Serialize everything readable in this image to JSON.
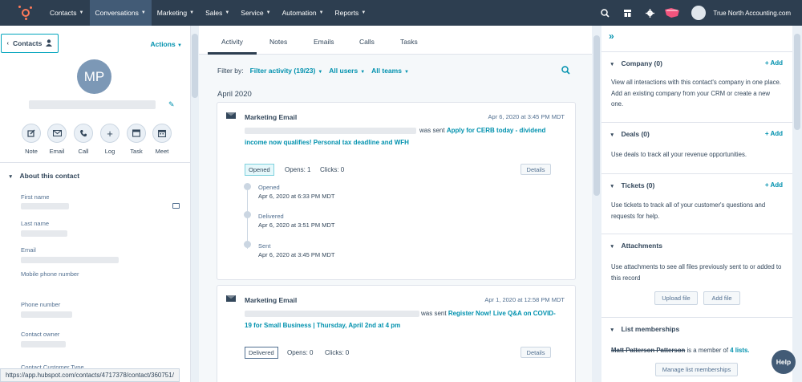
{
  "topnav": {
    "items": [
      {
        "label": "Contacts",
        "active": false
      },
      {
        "label": "Conversations",
        "active": true
      },
      {
        "label": "Marketing",
        "active": false
      },
      {
        "label": "Sales",
        "active": false
      },
      {
        "label": "Service",
        "active": false
      },
      {
        "label": "Automation",
        "active": false
      },
      {
        "label": "Reports",
        "active": false
      }
    ],
    "account": "True North Accounting.com"
  },
  "left": {
    "back_label": "Contacts",
    "actions_label": "Actions",
    "avatar_initials": "MP",
    "quick_actions": [
      {
        "label": "Note",
        "icon": "note-icon"
      },
      {
        "label": "Email",
        "icon": "email-icon"
      },
      {
        "label": "Call",
        "icon": "call-icon"
      },
      {
        "label": "Log",
        "icon": "plus-icon"
      },
      {
        "label": "Task",
        "icon": "task-icon"
      },
      {
        "label": "Meet",
        "icon": "calendar-icon"
      }
    ],
    "about_title": "About this contact",
    "properties": [
      {
        "label": "First name"
      },
      {
        "label": "Last name"
      },
      {
        "label": "Email"
      },
      {
        "label": "Mobile phone number"
      },
      {
        "label": "Phone number"
      },
      {
        "label": "Contact owner"
      },
      {
        "label": "Contact Customer Type"
      }
    ]
  },
  "middle": {
    "tabs": [
      "Activity",
      "Notes",
      "Emails",
      "Calls",
      "Tasks"
    ],
    "filter": {
      "label": "Filter by:",
      "activity": "Filter activity (19/23)",
      "users": "All users",
      "teams": "All teams"
    },
    "month": "April 2020",
    "cards": [
      {
        "title": "Marketing Email",
        "date": "Apr 6, 2020 at 3:45 PM MDT",
        "sent_word": "was sent",
        "subject": "Apply for CERB today - dividend income now qualifies! Personal tax deadline and WFH",
        "status": "Opened",
        "opens": "Opens: 1",
        "clicks": "Clicks: 0",
        "details": "Details",
        "timeline": [
          {
            "label": "Opened",
            "date": "Apr 6, 2020 at 6:33 PM MDT"
          },
          {
            "label": "Delivered",
            "date": "Apr 6, 2020 at 3:51 PM MDT"
          },
          {
            "label": "Sent",
            "date": "Apr 6, 2020 at 3:45 PM MDT"
          }
        ]
      },
      {
        "title": "Marketing Email",
        "date": "Apr 1, 2020 at 12:58 PM MDT",
        "sent_word": "was sent",
        "subject": "Register Now! Live Q&A on COVID-19 for Small Business | Thursday, April 2nd at 4 pm",
        "status": "Delivered",
        "opens": "Opens: 0",
        "clicks": "Clicks: 0",
        "details": "Details"
      }
    ]
  },
  "right": {
    "sections": [
      {
        "title": "Company (0)",
        "add": "+ Add",
        "text": "View all interactions with this contact's company in one place. Add an existing company from your CRM or create a new one."
      },
      {
        "title": "Deals (0)",
        "add": "+ Add",
        "text": "Use deals to track all your revenue opportunities."
      },
      {
        "title": "Tickets (0)",
        "add": "+ Add",
        "text": "Use tickets to track all of your customer's questions and requests for help."
      },
      {
        "title": "Attachments",
        "add": "",
        "text": "Use attachments to see all files previously sent to or added to this record",
        "buttons": [
          "Upload file",
          "Add file"
        ]
      },
      {
        "title": "List memberships",
        "add": "",
        "member_name": "Matt Patterson Patterson",
        "member_text": "is a member of",
        "member_link": "4 lists.",
        "button": "Manage list memberships"
      }
    ]
  },
  "help_label": "Help",
  "status_url": "https://app.hubspot.com/contacts/4717378/contact/360751/"
}
